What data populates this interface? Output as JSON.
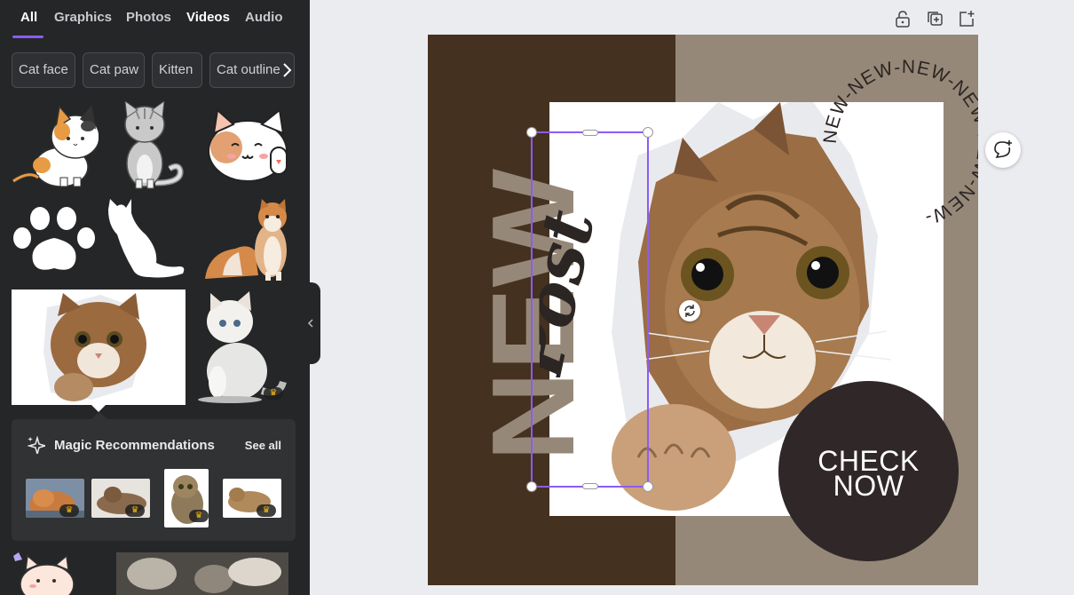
{
  "sidebar": {
    "tabs": [
      {
        "label": "All",
        "active": true
      },
      {
        "label": "Graphics"
      },
      {
        "label": "Photos"
      },
      {
        "label": "Videos"
      },
      {
        "label": "Audio"
      }
    ],
    "chips": [
      "Cat face",
      "Cat paw",
      "Kitten",
      "Cat outline"
    ],
    "chips_next_icon": "chevron-right-icon",
    "results": [
      {
        "name": "calico-cat-sticker"
      },
      {
        "name": "gray-cat-sticker"
      },
      {
        "name": "waving-cat-sticker"
      },
      {
        "name": "cat-paw-graphic"
      },
      {
        "name": "white-cat-silhouette"
      },
      {
        "name": "orange-cat-photo"
      },
      {
        "name": "cat-peeking-through-paper-photo"
      },
      {
        "name": "white-fluffy-cat-photo",
        "premium": true
      }
    ],
    "magic": {
      "title": "Magic Recommendations",
      "see_all": "See all",
      "icon": "sparkle-icon",
      "items": [
        {
          "premium": true
        },
        {
          "premium": true
        },
        {
          "premium": true
        },
        {
          "premium": true
        }
      ]
    },
    "collapse_icon": "chevron-left-icon"
  },
  "toolbar": {
    "icons": [
      "lock-open-icon",
      "duplicate-icon",
      "add-page-icon"
    ]
  },
  "design": {
    "vertical_text": "NEW",
    "script_text": "Post",
    "cta": {
      "line1": "CHECK",
      "line2": "NOW"
    },
    "circle_text": "NEW-NEW-NEW-NEW-NEW-NEW-",
    "colors": {
      "dark_brown": "#45311f",
      "taupe": "#968878",
      "cta_bg": "#2f2728",
      "selection": "#8b5cf6"
    }
  },
  "comment_icon": "add-comment-icon"
}
